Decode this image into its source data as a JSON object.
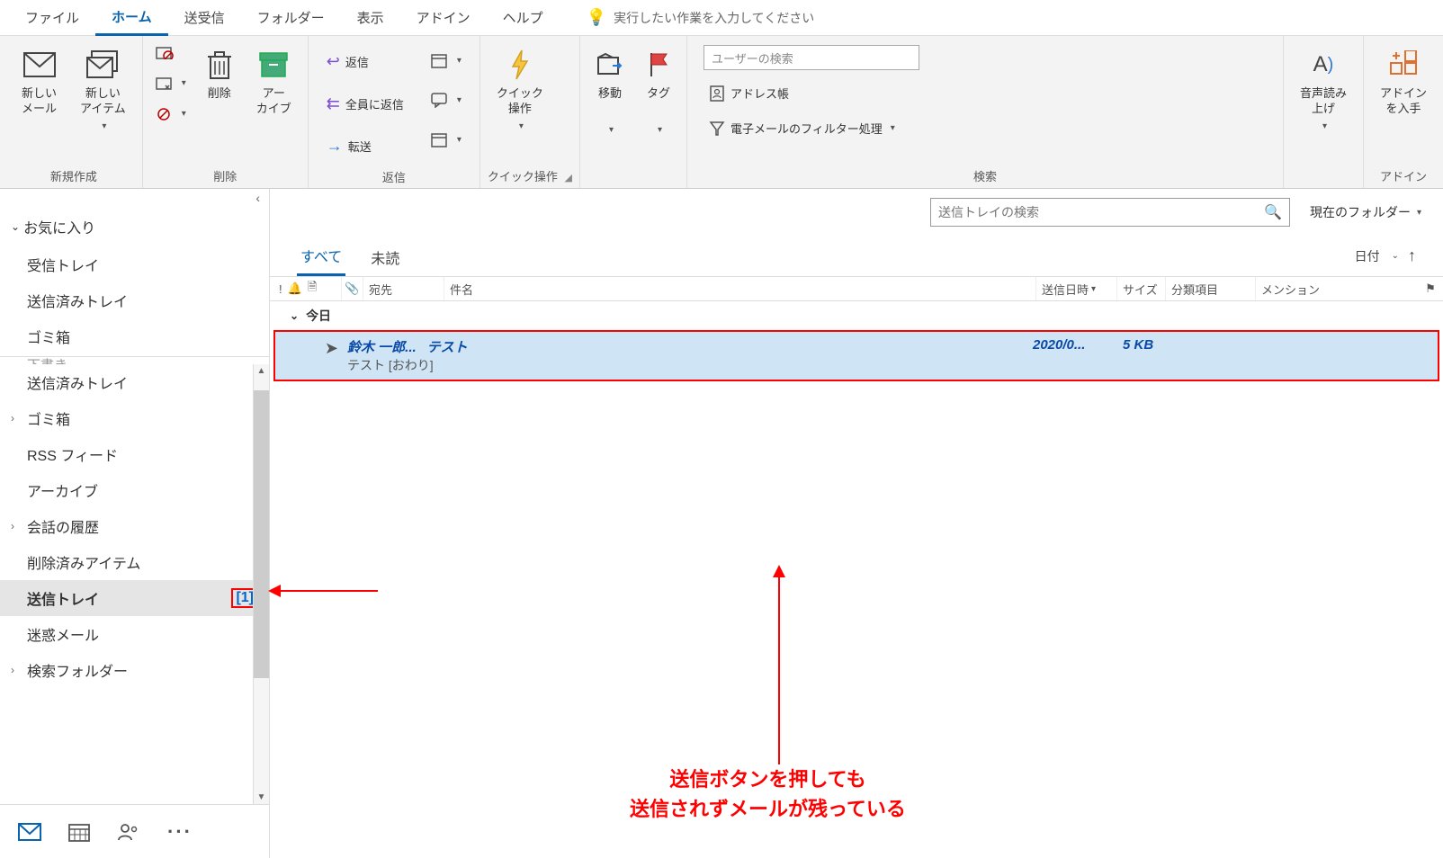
{
  "menu": {
    "file": "ファイル",
    "home": "ホーム",
    "sendrecv": "送受信",
    "folder": "フォルダー",
    "view": "表示",
    "addin": "アドイン",
    "help": "ヘルプ",
    "tellme": "実行したい作業を入力してください"
  },
  "ribbon": {
    "new_mail": "新しい\nメール",
    "new_item": "新しい\nアイテム",
    "delete": "削除",
    "archive": "アー\nカイブ",
    "reply": "返信",
    "reply_all": "全員に返信",
    "forward": "転送",
    "quick": "クイック\n操作",
    "move": "移動",
    "tag": "タグ",
    "search_user": "ユーザーの検索",
    "address_book": "アドレス帳",
    "email_filter": "電子メールのフィルター処理",
    "read_aloud": "音声読み\n上げ",
    "get_addins": "アドイン\nを入手",
    "groups": {
      "create": "新規作成",
      "delete": "削除",
      "reply": "返信",
      "quick": "クイック操作",
      "search": "検索",
      "addin": "アドイン"
    }
  },
  "sidebar": {
    "favorites": "お気に入り",
    "inbox": "受信トレイ",
    "sent": "送信済みトレイ",
    "trash": "ゴミ箱",
    "peek": "下書き",
    "sent2": "送信済みトレイ",
    "trash2": "ゴミ箱",
    "rss": "RSS フィード",
    "archive": "アーカイブ",
    "conv": "会話の履歴",
    "deleted": "削除済みアイテム",
    "outbox": "送信トレイ",
    "outbox_count": "[1]",
    "junk": "迷惑メール",
    "search_folder": "検索フォルダー"
  },
  "list": {
    "search_placeholder": "送信トレイの検索",
    "scope": "現在のフォルダー",
    "tab_all": "すべて",
    "tab_unread": "未読",
    "sort_by": "日付",
    "headers": {
      "to": "宛先",
      "subject": "件名",
      "date": "送信日時",
      "size": "サイズ",
      "category": "分類項目",
      "mention": "メンション"
    },
    "group_today": "今日",
    "mail": {
      "to": "鈴木 一郎...",
      "subject": "テスト",
      "preview": "テスト [おわり]",
      "date": "2020/0...",
      "size": "5 KB"
    }
  },
  "annotation": {
    "line1": "送信ボタンを押しても",
    "line2": "送信されずメールが残っている"
  }
}
